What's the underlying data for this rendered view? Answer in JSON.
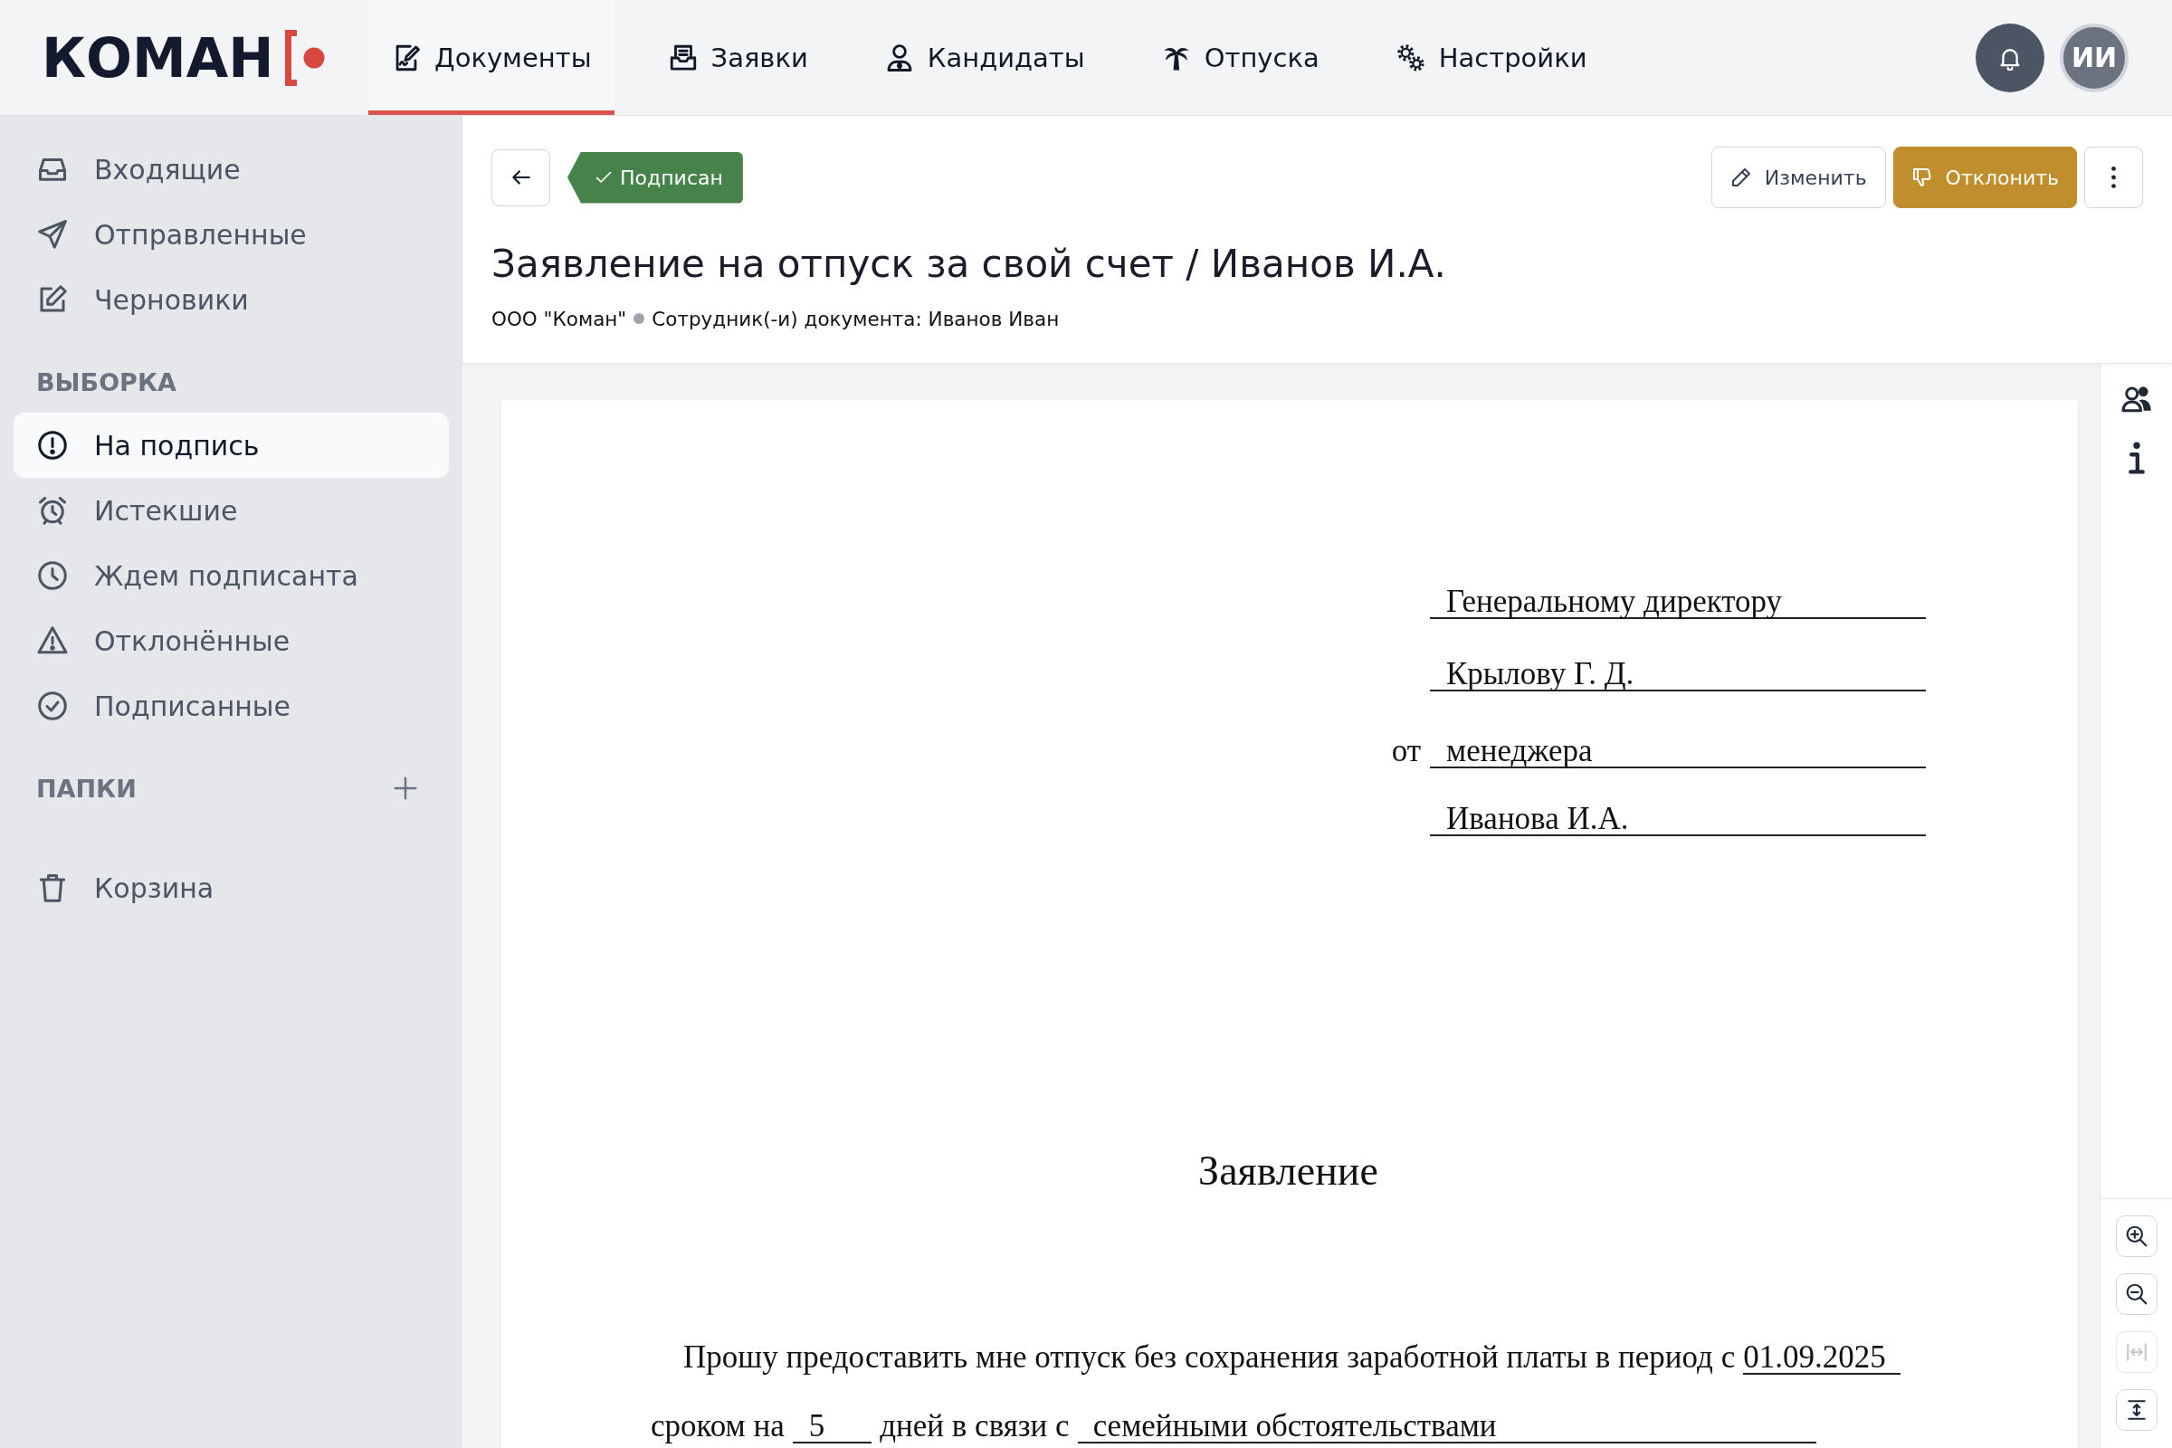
{
  "header": {
    "logo": "КОМАН",
    "tabs": [
      {
        "label": "Документы",
        "selected": true
      },
      {
        "label": "Заявки",
        "selected": false
      },
      {
        "label": "Кандидаты",
        "selected": false
      },
      {
        "label": "Отпуска",
        "selected": false
      },
      {
        "label": "Настройки",
        "selected": false
      }
    ],
    "avatar": "ИИ"
  },
  "sidebar": {
    "items": [
      {
        "label": "Входящие",
        "selected": false
      },
      {
        "label": "Отправленные",
        "selected": false
      },
      {
        "label": "Черновики",
        "selected": false
      }
    ],
    "sections": [
      {
        "title": "ВЫБОРКА",
        "addable": false,
        "items": [
          {
            "label": "На подпись",
            "selected": true
          },
          {
            "label": "Истекшие",
            "selected": false
          },
          {
            "label": "Ждем подписанта",
            "selected": false
          },
          {
            "label": "Отклонённые",
            "selected": false
          },
          {
            "label": "Подписанные",
            "selected": false
          }
        ]
      },
      {
        "title": "ПАПКИ",
        "addable": true
      }
    ],
    "footer_items": [
      {
        "label": "Корзина",
        "selected": false
      }
    ]
  },
  "document_header": {
    "status": "Подписан",
    "title": "Заявление на отпуск за свой счет / Иванов И.А.",
    "organization": "ООО \"Коман\"",
    "employees": "Сотрудник(-и) документа: Иванов Иван",
    "actions": [
      {
        "label": "Изменить",
        "kind": "secondary"
      },
      {
        "label": "Отклонить",
        "kind": "primary"
      }
    ]
  },
  "document": {
    "addressee": [
      {
        "value": "Генеральному директору"
      },
      {
        "value": "Крылову Г. Д."
      },
      {
        "prefix": "от",
        "value": "менеджера"
      },
      {
        "value": "Иванова И.А."
      }
    ],
    "heading": "Заявление",
    "body": [
      {
        "segments": [
          {
            "kind": "text",
            "text": "Прошу предоставить мне отпуск без сохранения заработной платы в период с"
          },
          {
            "kind": "blank",
            "value": "01.09.2025"
          }
        ]
      },
      {
        "segments": [
          {
            "kind": "text",
            "text": "сроком на"
          },
          {
            "kind": "blank",
            "value": "5"
          },
          {
            "kind": "text",
            "text": "дней в связи с"
          },
          {
            "kind": "blank",
            "value": "семейными обстоятельствами"
          }
        ]
      }
    ]
  },
  "viewer_tools": {
    "zoom_controls": [
      {
        "disabled": false
      },
      {
        "disabled": false
      },
      {
        "disabled": true
      },
      {
        "disabled": false
      }
    ]
  }
}
